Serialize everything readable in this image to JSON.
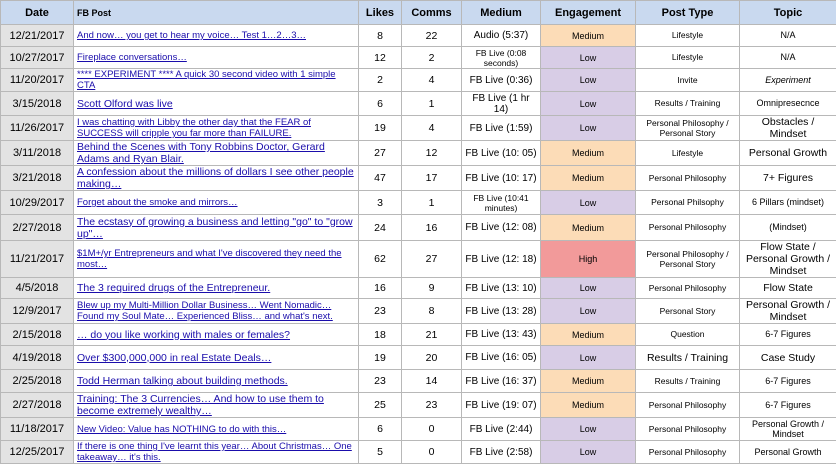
{
  "headers": {
    "date": "Date",
    "post": "FB Post",
    "likes": "Likes",
    "comms": "Comms",
    "medium": "Medium",
    "engagement": "Engagement",
    "post_type": "Post Type",
    "topic": "Topic"
  },
  "colors": {
    "header_bg": "#c9d9ef",
    "date_bg": "#e3e3e3",
    "engagement_low": "#d8cde6",
    "engagement_medium": "#fcdcb7",
    "engagement_high": "#f29a9a",
    "link": "#1a0dab"
  },
  "rows": [
    {
      "date": "12/21/2017",
      "post": "And now… you get to hear my voice… Test 1…2…3…",
      "likes": "8",
      "comms": "22",
      "medium": "Audio (5:37)",
      "engagement": "Medium",
      "post_type": "Lifestyle",
      "topic": "N/A"
    },
    {
      "date": "10/27/2017",
      "post": "Fireplace conversations…",
      "likes": "12",
      "comms": "2",
      "medium": "FB Live (0:08 seconds)",
      "engagement": "Low",
      "post_type": "Lifestyle",
      "topic": "N/A"
    },
    {
      "date": "11/20/2017",
      "post": "**** EXPERIMENT **** A quick 30 second video with 1 simple CTA",
      "likes": "2",
      "comms": "4",
      "medium": "FB Live (0:36)",
      "engagement": "Low",
      "post_type": "Invite",
      "topic": "Experiment"
    },
    {
      "date": "3/15/2018",
      "post": "Scott Olford was live",
      "likes": "6",
      "comms": "1",
      "medium": "FB Live (1 hr 14)",
      "engagement": "Low",
      "post_type": "Results / Training",
      "topic": "Omnipresecnce"
    },
    {
      "date": "11/26/2017",
      "post": "I was chatting with Libby the other day that the FEAR of SUCCESS will cripple you far more than FAILURE.",
      "likes": "19",
      "comms": "4",
      "medium": "FB Live (1:59)",
      "engagement": "Low",
      "post_type": "Personal Philosophy / Personal Story",
      "topic": "Obstacles / Mindset"
    },
    {
      "date": "3/11/2018",
      "post": "Behind the Scenes with Tony Robbins Doctor, Gerard Adams and Ryan Blair.",
      "likes": "27",
      "comms": "12",
      "medium": "FB Live (10: 05)",
      "engagement": "Medium",
      "post_type": "Lifestyle",
      "topic": "Personal Growth"
    },
    {
      "date": "3/21/2018",
      "post": "A confession about the millions of dollars I see other people making…",
      "likes": "47",
      "comms": "17",
      "medium": "FB Live (10: 17)",
      "engagement": "Medium",
      "post_type": "Personal Philosophy",
      "topic": "7+ Figures"
    },
    {
      "date": "10/29/2017",
      "post": "Forget about the smoke and mirrors…",
      "likes": "3",
      "comms": "1",
      "medium": "FB Live (10:41 minutes)",
      "engagement": "Low",
      "post_type": "Personal Philsophy",
      "topic": "6 Pillars (mindset)"
    },
    {
      "date": "2/27/2018",
      "post": "The ecstasy of growing a business and letting \"go\" to \"grow up\"…",
      "likes": "24",
      "comms": "16",
      "medium": "FB Live (12: 08)",
      "engagement": "Medium",
      "post_type": "Personal Philosophy",
      "topic": "(Mindset)"
    },
    {
      "date": "11/21/2017",
      "post": "$1M+/yr Entrepreneurs and what I've discovered they need the most…",
      "likes": "62",
      "comms": "27",
      "medium": "FB Live (12: 18)",
      "engagement": "High",
      "post_type": "Personal Philosophy / Personal Story",
      "topic": "Flow State / Personal Growth / Mindset"
    },
    {
      "date": "4/5/2018",
      "post": "The 3 required drugs of the Entrepreneur.",
      "likes": "16",
      "comms": "9",
      "medium": "FB Live (13: 10)",
      "engagement": "Low",
      "post_type": "Personal Philosophy",
      "topic": "Flow State"
    },
    {
      "date": "12/9/2017",
      "post": "Blew up my Multi-Million Dollar Business… Went Nomadic… Found my Soul Mate… Experienced Bliss… and what's next.",
      "likes": "23",
      "comms": "8",
      "medium": "FB Live (13: 28)",
      "engagement": "Low",
      "post_type": "Personal Story",
      "topic": "Personal Growth / Mindset"
    },
    {
      "date": "2/15/2018",
      "post": "… do you like working with males or females?",
      "likes": "18",
      "comms": "21",
      "medium": "FB Live (13: 43)",
      "engagement": "Medium",
      "post_type": "Question",
      "topic": "6-7 Figures"
    },
    {
      "date": "4/19/2018",
      "post": "Over $300,000,000 in real Estate Deals…",
      "likes": "19",
      "comms": "20",
      "medium": "FB Live (16: 05)",
      "engagement": "Low",
      "post_type": "Results / Training",
      "topic": "Case Study"
    },
    {
      "date": "2/25/2018",
      "post": "Todd Herman talking about building methods.",
      "likes": "23",
      "comms": "14",
      "medium": "FB Live (16: 37)",
      "engagement": "Medium",
      "post_type": "Results / Training",
      "topic": "6-7 Figures"
    },
    {
      "date": "2/27/2018",
      "post": "Training: The 3 Currencies… And how to use them to become extremely wealthy…",
      "likes": "25",
      "comms": "23",
      "medium": "FB Live (19: 07)",
      "engagement": "Medium",
      "post_type": "Personal Philosophy",
      "topic": "6-7 Figures"
    },
    {
      "date": "11/18/2017",
      "post": "New Video: Value has NOTHING to do with this…",
      "likes": "6",
      "comms": "0",
      "medium": "FB Live (2:44)",
      "engagement": "Low",
      "post_type": "Personal Philosophy",
      "topic": "Personal Growth / Mindset"
    },
    {
      "date": "12/25/2017",
      "post": "If there is one thing I've learnt this year… About Christmas… One takeaway… it's this.",
      "likes": "5",
      "comms": "0",
      "medium": "FB Live (2:58)",
      "engagement": "Low",
      "post_type": "Personal Philosophy",
      "topic": "Personal Growth"
    }
  ]
}
